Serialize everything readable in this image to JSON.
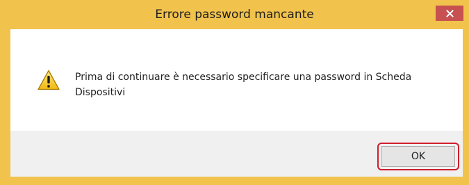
{
  "dialog": {
    "title": "Errore password mancante",
    "message": "Prima di continuare è necessario specificare una password in Scheda Dispositivi",
    "ok_label": "OK",
    "icon": "warning-icon",
    "close_icon": "close-icon"
  },
  "colors": {
    "frame": "#f1c24c",
    "close_button": "#c75050",
    "highlight": "#d11d2c",
    "button_bar": "#f0f0f0"
  }
}
